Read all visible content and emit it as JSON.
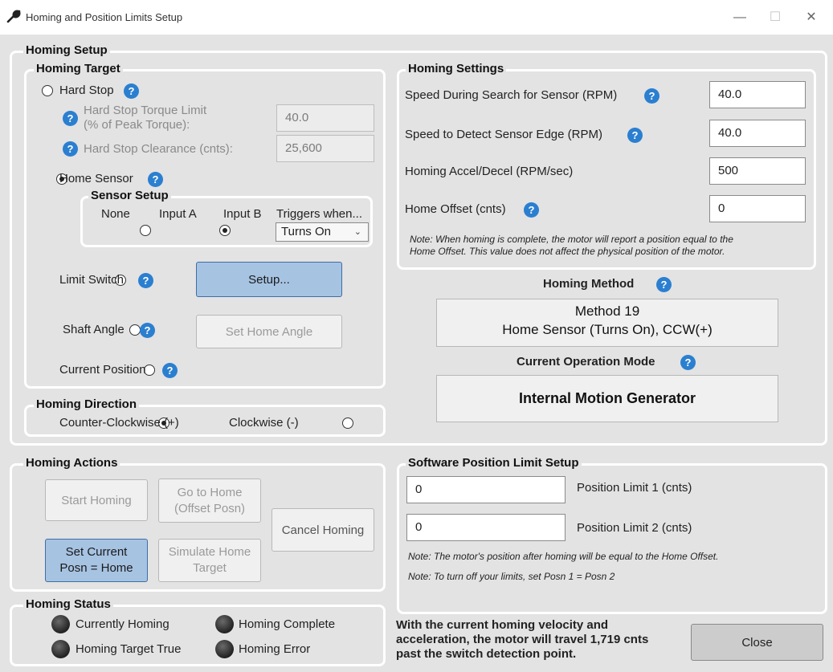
{
  "window": {
    "title": "Homing and Position Limits Setup",
    "minimize": "—",
    "maximize": "☐",
    "close": "✕"
  },
  "groups": {
    "homing_setup": "Homing Setup",
    "homing_target": "Homing Target",
    "homing_settings": "Homing Settings",
    "homing_direction": "Homing Direction",
    "homing_actions": "Homing Actions",
    "homing_status": "Homing Status",
    "software_limits": "Software Position Limit Setup",
    "sensor_setup": "Sensor Setup"
  },
  "help_glyph": "?",
  "target": {
    "hard_stop": "Hard Stop",
    "torque_label_1": "Hard Stop Torque Limit",
    "torque_label_2": "(% of Peak Torque):",
    "torque_value": "40.0",
    "clearance_label": "Hard Stop Clearance (cnts):",
    "clearance_value": "25,600",
    "home_sensor": "Home Sensor",
    "sensor_none": "None",
    "sensor_input_a": "Input A",
    "sensor_input_b": "Input B",
    "triggers_label": "Triggers when...",
    "triggers_value": "Turns On",
    "limit_switch": "Limit Switch",
    "setup_button": "Setup...",
    "shaft_angle": "Shaft Angle",
    "set_home_angle": "Set Home Angle",
    "current_position": "Current Position"
  },
  "direction": {
    "ccw": "Counter-Clockwise (+)",
    "cw": "Clockwise (-)"
  },
  "settings": {
    "search_label": "Speed During Search for Sensor (RPM)",
    "search_value": "40.0",
    "edge_label": "Speed to Detect Sensor Edge (RPM)",
    "edge_value": "40.0",
    "accel_label": "Homing Accel/Decel (RPM/sec)",
    "accel_value": "500",
    "offset_label": "Home Offset (cnts)",
    "offset_value": "0",
    "note_1": "Note: When homing is complete, the motor will report a position equal to the",
    "note_2": "Home Offset. This value does not affect the physical position of the motor."
  },
  "method": {
    "label": "Homing Method",
    "line1": "Method 19",
    "line2": "Home Sensor (Turns On), CCW(+)",
    "op_label": "Current Operation Mode",
    "op_value": "Internal Motion Generator"
  },
  "actions": {
    "start": "Start Homing",
    "goto_1": "Go to Home",
    "goto_2": "(Offset Posn)",
    "cancel": "Cancel Homing",
    "set_current_1": "Set Current",
    "set_current_2": "Posn = Home",
    "simulate_1": "Simulate Home",
    "simulate_2": "Target"
  },
  "limits": {
    "limit1_value": "0",
    "limit1_label": "Position Limit 1 (cnts)",
    "limit2_value": "0",
    "limit2_label": "Position Limit 2 (cnts)",
    "note_1": "Note: The motor's position after homing will be equal to the Home Offset.",
    "note_2": "Note: To turn off your limits, set Posn 1 = Posn 2"
  },
  "status": {
    "currently_homing": "Currently Homing",
    "homing_complete": "Homing Complete",
    "target_true": "Homing Target True",
    "homing_error": "Homing Error"
  },
  "footer": {
    "line1": "With the current homing velocity and",
    "line2": "acceleration, the motor will travel 1,719 cnts",
    "line3": "past the switch detection point.",
    "close": "Close"
  }
}
